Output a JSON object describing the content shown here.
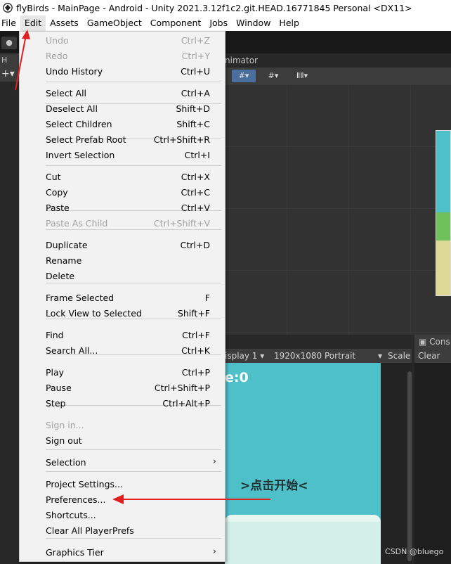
{
  "window": {
    "title": "flyBirds - MainPage - Android - Unity 2021.3.12f1c2.git.HEAD.16771845 Personal <DX11>"
  },
  "menubar": [
    "File",
    "Edit",
    "Assets",
    "GameObject",
    "Component",
    "Jobs",
    "Window",
    "Help"
  ],
  "active_menu": "Edit",
  "hierarchy": {
    "tab_label": "H",
    "add_label": "+▾"
  },
  "scene": {
    "tab_label": "nimator"
  },
  "game": {
    "display": "isplay 1",
    "resolution": "1920x1080 Portrait",
    "scale_label": "Scale",
    "score_text": "e:0",
    "start_text": ">点击开始<"
  },
  "console": {
    "tab_label": "Cons",
    "clear_label": "Clear"
  },
  "edit_menu": {
    "items": [
      {
        "label": "Undo",
        "shortcut": "Ctrl+Z",
        "disabled": true
      },
      {
        "label": "Redo",
        "shortcut": "Ctrl+Y",
        "disabled": true
      },
      {
        "label": "Undo History",
        "shortcut": "Ctrl+U",
        "disabled": false
      },
      {
        "label": "Select All",
        "shortcut": "Ctrl+A",
        "disabled": false
      },
      {
        "label": "Deselect All",
        "shortcut": "Shift+D",
        "disabled": false
      },
      {
        "label": "Select Children",
        "shortcut": "Shift+C",
        "disabled": false
      },
      {
        "label": "Select Prefab Root",
        "shortcut": "Ctrl+Shift+R",
        "disabled": false
      },
      {
        "label": "Invert Selection",
        "shortcut": "Ctrl+I",
        "disabled": false
      },
      {
        "label": "Cut",
        "shortcut": "Ctrl+X",
        "disabled": false
      },
      {
        "label": "Copy",
        "shortcut": "Ctrl+C",
        "disabled": false
      },
      {
        "label": "Paste",
        "shortcut": "Ctrl+V",
        "disabled": false
      },
      {
        "label": "Paste As Child",
        "shortcut": "Ctrl+Shift+V",
        "disabled": true
      },
      {
        "label": "Duplicate",
        "shortcut": "Ctrl+D",
        "disabled": false
      },
      {
        "label": "Rename",
        "shortcut": "",
        "disabled": false
      },
      {
        "label": "Delete",
        "shortcut": "",
        "disabled": false
      },
      {
        "label": "Frame Selected",
        "shortcut": "F",
        "disabled": false
      },
      {
        "label": "Lock View to Selected",
        "shortcut": "Shift+F",
        "disabled": false
      },
      {
        "label": "Find",
        "shortcut": "Ctrl+F",
        "disabled": false
      },
      {
        "label": "Search All...",
        "shortcut": "Ctrl+K",
        "disabled": false
      },
      {
        "label": "Play",
        "shortcut": "Ctrl+P",
        "disabled": false
      },
      {
        "label": "Pause",
        "shortcut": "Ctrl+Shift+P",
        "disabled": false
      },
      {
        "label": "Step",
        "shortcut": "Ctrl+Alt+P",
        "disabled": false
      },
      {
        "label": "Sign in...",
        "shortcut": "",
        "disabled": true
      },
      {
        "label": "Sign out",
        "shortcut": "",
        "disabled": false
      },
      {
        "label": "Selection",
        "shortcut": "",
        "disabled": false,
        "submenu": true
      },
      {
        "label": "Project Settings...",
        "shortcut": "",
        "disabled": false
      },
      {
        "label": "Preferences...",
        "shortcut": "",
        "disabled": false
      },
      {
        "label": "Shortcuts...",
        "shortcut": "",
        "disabled": false
      },
      {
        "label": "Clear All PlayerPrefs",
        "shortcut": "",
        "disabled": false
      },
      {
        "label": "Graphics Tier",
        "shortcut": "",
        "disabled": false,
        "submenu": true
      }
    ]
  },
  "annotations": {
    "arrow_color": "#e02020"
  },
  "watermark": "CSDN @bluego"
}
